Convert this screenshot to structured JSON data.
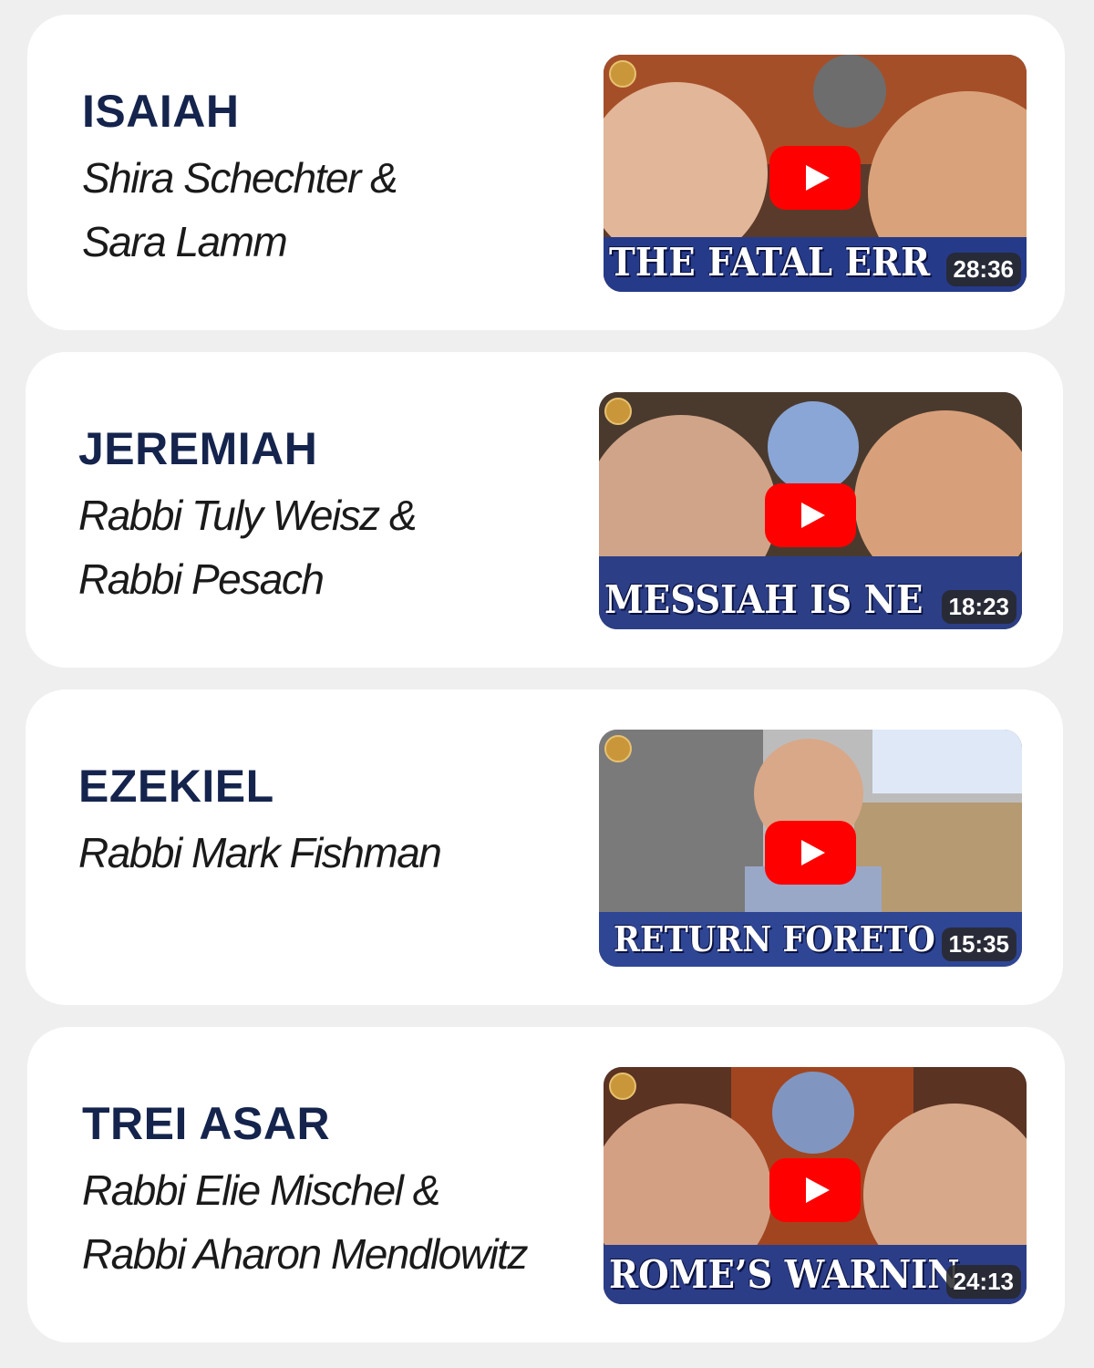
{
  "colors": {
    "page_bg": "#efefef",
    "card_bg": "#ffffff",
    "title": "#15244d",
    "play": "#ff0000"
  },
  "books": [
    {
      "name": "ISAIAH",
      "authors": [
        "Shira Schechter &",
        "Sara Lamm"
      ],
      "video": {
        "caption": "THE FATAL ERR",
        "duration": "28:36"
      }
    },
    {
      "name": "JEREMIAH",
      "authors": [
        "Rabbi Tuly Weisz &",
        "Rabbi Pesach"
      ],
      "video": {
        "caption": "MESSIAH IS NE",
        "duration": "18:23"
      }
    },
    {
      "name": "EZEKIEL",
      "authors": [
        "Rabbi Mark Fishman"
      ],
      "video": {
        "caption": "RETURN FORETO",
        "duration": "15:35"
      }
    },
    {
      "name": "TREI ASAR",
      "authors": [
        "Rabbi Elie Mischel &",
        "Rabbi Aharon Mendlowitz"
      ],
      "video": {
        "caption": "ROME’S WARNIN",
        "duration": "24:13"
      }
    }
  ]
}
